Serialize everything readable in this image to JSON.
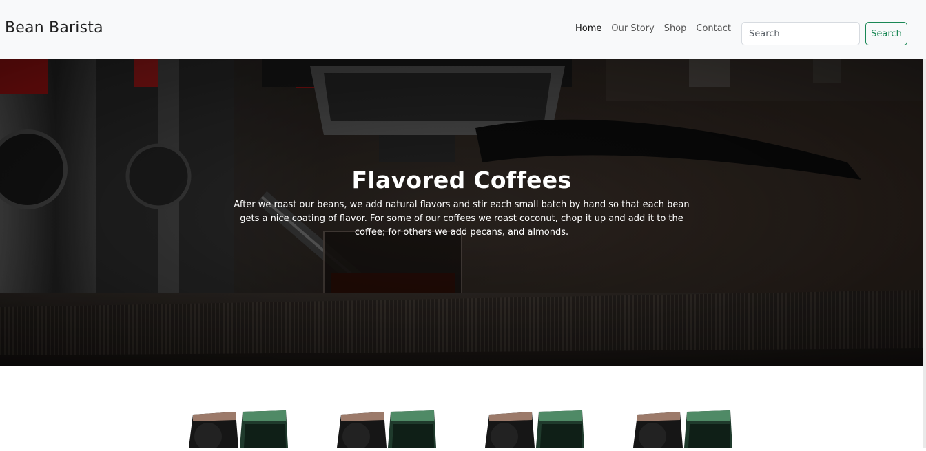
{
  "brand": "Bean Barista",
  "nav": {
    "items": [
      {
        "label": "Home",
        "active": true
      },
      {
        "label": "Our Story",
        "active": false
      },
      {
        "label": "Shop",
        "active": false
      },
      {
        "label": "Contact",
        "active": false
      }
    ]
  },
  "search": {
    "placeholder": "Search",
    "button_label": "Search"
  },
  "hero": {
    "title": "Flavored Coffees",
    "text": "After we roast our beans, we add natural flavors and stir each small batch by hand so that each bean gets a nice coating of flavor. For some of our coffees we roast coconut, chop it up and add it to the coffee; for others we add pecans, and almonds."
  },
  "colors": {
    "accent": "#198754",
    "navbar_bg": "#f8f9fa",
    "bag_black": "#161616",
    "bag_green": "#1f3a2c",
    "bag_top_brown": "#9c7a6a",
    "bag_top_green": "#4f8a66"
  },
  "products": [
    {
      "image": "coffee-bags-image"
    },
    {
      "image": "coffee-bags-image"
    },
    {
      "image": "coffee-bags-image"
    },
    {
      "image": "coffee-bags-image"
    }
  ]
}
